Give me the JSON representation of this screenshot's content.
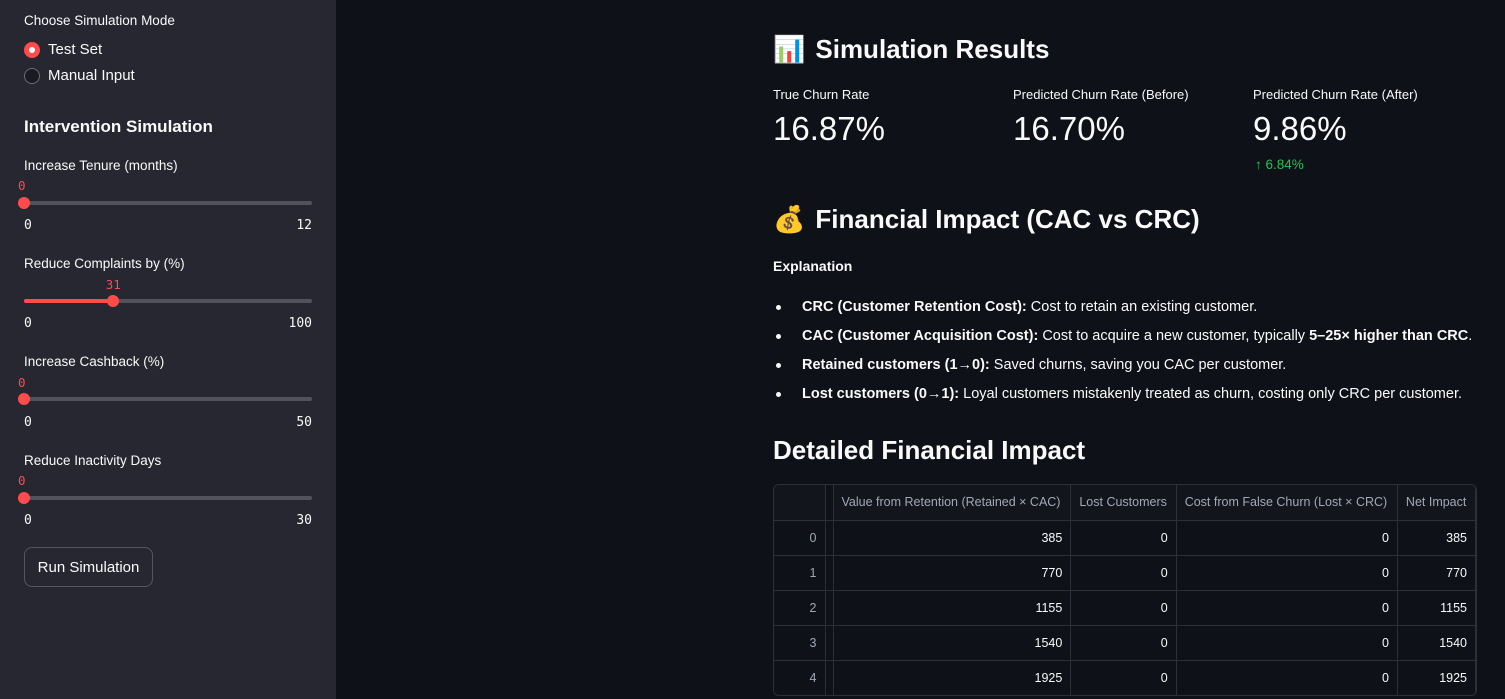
{
  "sidebar": {
    "mode_label": "Choose Simulation Mode",
    "modes": [
      {
        "label": "Test Set",
        "selected": true
      },
      {
        "label": "Manual Input",
        "selected": false
      }
    ],
    "intervention_heading": "Intervention Simulation",
    "sliders": [
      {
        "label": "Increase Tenure (months)",
        "value": "0",
        "min": "0",
        "max": "12",
        "fraction": 0
      },
      {
        "label": "Reduce Complaints by (%)",
        "value": "31",
        "min": "0",
        "max": "100",
        "fraction": 0.31
      },
      {
        "label": "Increase Cashback (%)",
        "value": "0",
        "min": "0",
        "max": "50",
        "fraction": 0
      },
      {
        "label": "Reduce Inactivity Days",
        "value": "0",
        "min": "0",
        "max": "30",
        "fraction": 0
      }
    ],
    "run_button": "Run Simulation"
  },
  "results": {
    "icon": "bar-chart-emoji",
    "emoji": "📊",
    "title": "Simulation Results",
    "metrics": [
      {
        "label": "True Churn Rate",
        "value": "16.87%"
      },
      {
        "label": "Predicted Churn Rate (Before)",
        "value": "16.70%"
      },
      {
        "label": "Predicted Churn Rate (After)",
        "value": "9.86%",
        "delta": "6.84%",
        "delta_arrow": "↑"
      }
    ]
  },
  "financial": {
    "icon": "money-bag-emoji",
    "emoji": "💰",
    "title": "Financial Impact (CAC vs CRC)",
    "explanation_title": "Explanation",
    "bullets": [
      {
        "bold": "CRC (Customer Retention Cost):",
        "text": " Cost to retain an existing customer.",
        "bold2": "",
        "tail": ""
      },
      {
        "bold": "CAC (Customer Acquisition Cost):",
        "text": " Cost to acquire a new customer, typically ",
        "bold2": "5–25× higher than CRC",
        "tail": "."
      },
      {
        "bold": "Retained customers (1→0):",
        "text": " Saved churns, saving you CAC per customer.",
        "bold2": "",
        "tail": ""
      },
      {
        "bold": "Lost customers (0→1):",
        "text": " Loyal customers mistakenly treated as churn, costing only CRC per customer.",
        "bold2": "",
        "tail": ""
      }
    ]
  },
  "detail": {
    "title": "Detailed Financial Impact",
    "columns": [
      "",
      "Value from Retention (Retained × CAC)",
      "Lost Customers",
      "Cost from False Churn (Lost × CRC)",
      "Net Impact"
    ],
    "rows": [
      [
        "0",
        "385",
        "0",
        "0",
        "385"
      ],
      [
        "1",
        "770",
        "0",
        "0",
        "770"
      ],
      [
        "2",
        "1155",
        "0",
        "0",
        "1155"
      ],
      [
        "3",
        "1540",
        "0",
        "0",
        "1540"
      ],
      [
        "4",
        "1925",
        "0",
        "0",
        "1925"
      ]
    ]
  },
  "colors": {
    "accent": "#ff4b4b",
    "delta_positive": "#21c354",
    "background": "#0e1117",
    "sidebar": "#262730"
  }
}
